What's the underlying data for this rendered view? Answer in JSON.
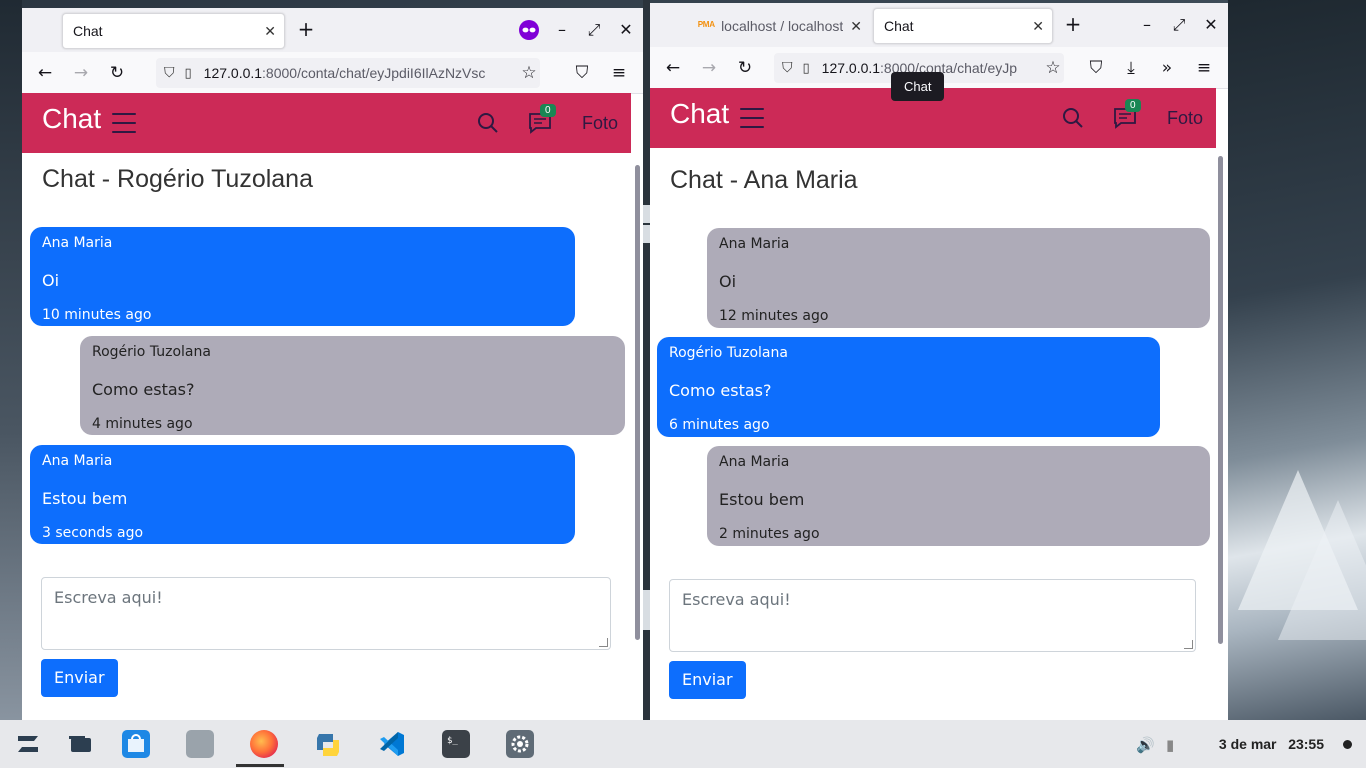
{
  "left_window": {
    "tab_title": "Chat",
    "url_host": "127.0.0.1",
    "url_rest": ":8000/conta/chat/eyJpdiI6IlAzNzVsc",
    "app_brand": "Chat",
    "badge_count": "0",
    "foto_label": "Foto",
    "page_title": "Chat - Rogério Tuzolana",
    "messages": [
      {
        "sender": "Ana Maria",
        "text": "Oi",
        "time": "10 minutes ago",
        "style": "blue"
      },
      {
        "sender": "Rogério Tuzolana",
        "text": "Como estas?",
        "time": "4 minutes ago",
        "style": "gray"
      },
      {
        "sender": "Ana Maria",
        "text": "Estou bem",
        "time": "3 seconds ago",
        "style": "blue"
      }
    ],
    "input_placeholder": "Escreva aqui!",
    "send_label": "Enviar"
  },
  "right_window": {
    "tabs": [
      {
        "label": "localhost / localhost",
        "active": false
      },
      {
        "label": "Chat",
        "active": true
      }
    ],
    "url_host": "127.0.0.1",
    "url_rest": ":8000/conta/chat/eyJp",
    "tooltip": "Chat",
    "app_brand": "Chat",
    "badge_count": "0",
    "foto_label": "Foto",
    "page_title": "Chat - Ana Maria",
    "messages": [
      {
        "sender": "Ana Maria",
        "text": "Oi",
        "time": "12 minutes ago",
        "style": "gray"
      },
      {
        "sender": "Rogério Tuzolana",
        "text": "Como estas?",
        "time": "6 minutes ago",
        "style": "blue"
      },
      {
        "sender": "Ana Maria",
        "text": "Estou bem",
        "time": "2 minutes ago",
        "style": "gray"
      }
    ],
    "input_placeholder": "Escreva aqui!",
    "send_label": "Enviar"
  },
  "taskbar": {
    "date": "3 de mar",
    "time": "23:55",
    "apps": [
      "zorin-menu-icon",
      "window-switcher-icon",
      "software-store-icon",
      "files-icon",
      "firefox-icon",
      "python-icon",
      "vscode-icon",
      "terminal-icon",
      "settings-icon"
    ]
  },
  "colors": {
    "app_nav": "#cc2a57",
    "bubble_blue": "#0d6efd",
    "bubble_gray": "#aeabb8",
    "badge": "#198754"
  }
}
